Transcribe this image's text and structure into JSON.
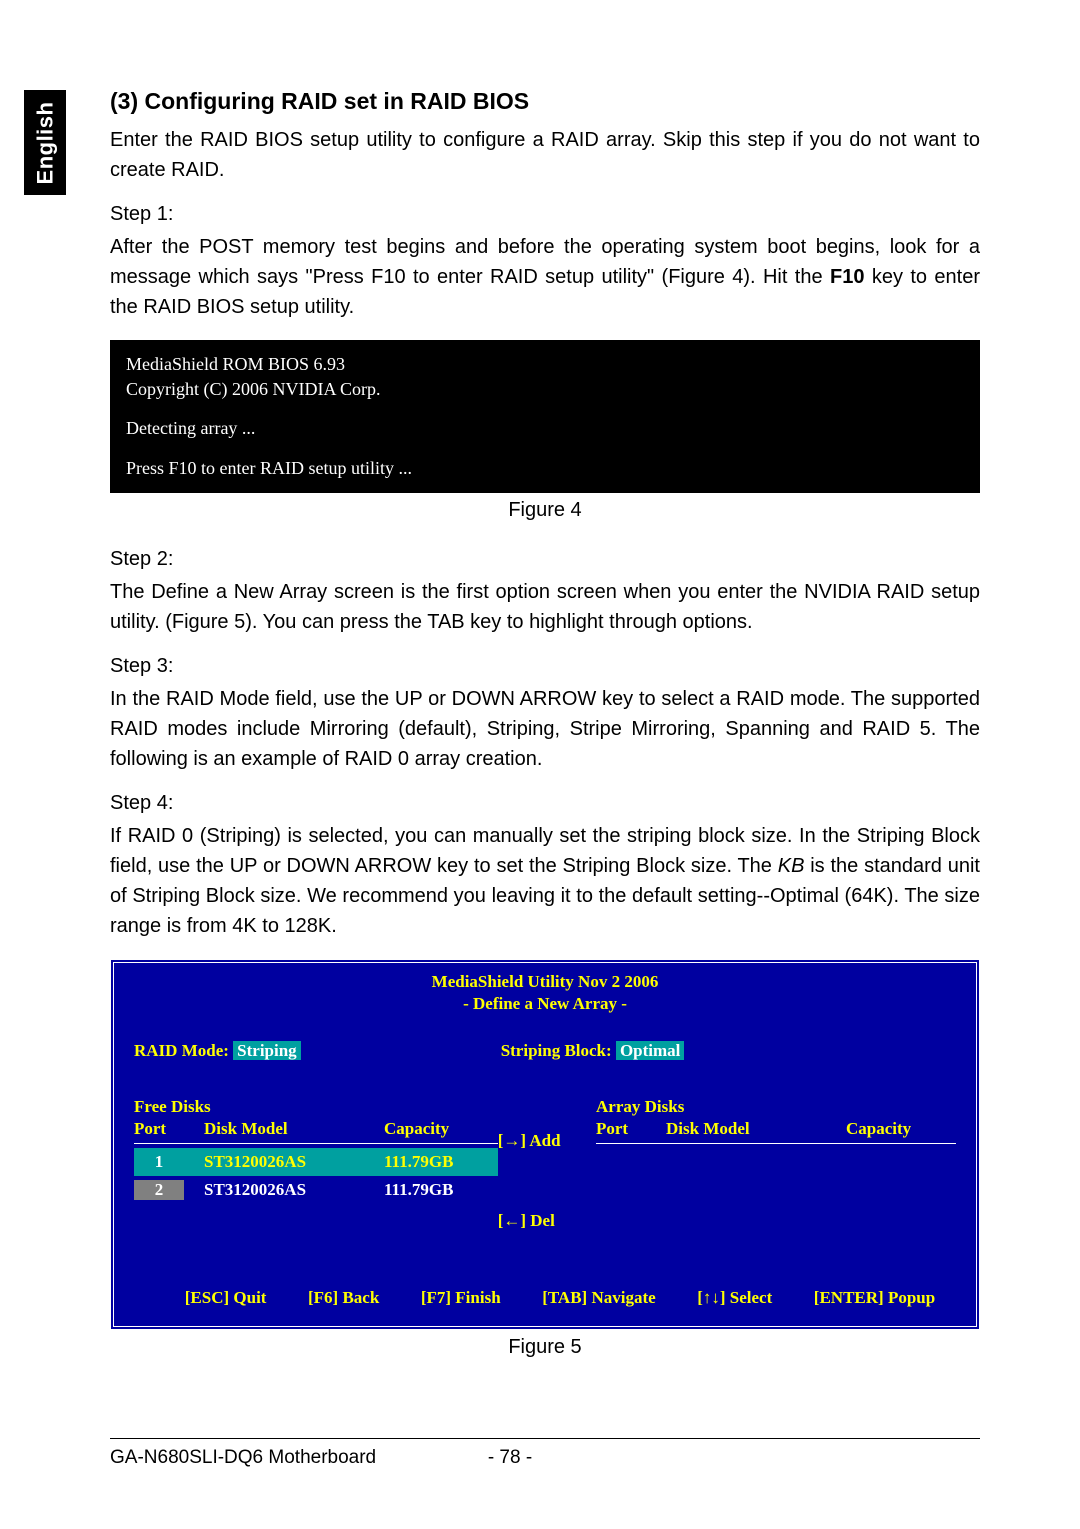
{
  "side_tab": "English",
  "heading": "(3)  Configuring RAID set in RAID BIOS",
  "intro": "Enter the RAID BIOS setup utility to configure a RAID array. Skip this step if you do not want to create RAID.",
  "step1_label": "Step 1:",
  "step1_text_before": "After the POST memory test begins and before the operating system boot begins, look for a message which says \"Press F10 to enter RAID setup utility\" (Figure 4). Hit the ",
  "step1_bold": "F10",
  "step1_text_after": " key to enter the RAID BIOS setup utility.",
  "figure4": {
    "line1": "MediaShield ROM BIOS 6.93",
    "line2": "Copyright (C) 2006 NVIDIA Corp.",
    "line3": "Detecting array ...",
    "line4": "Press F10 to enter RAID setup utility ..."
  },
  "figure4_caption": "Figure 4",
  "step2_label": "Step 2:",
  "step2_text": "The Define a New Array screen is the first option screen when you enter the NVIDIA RAID setup utility. (Figure 5). You can press the TAB key to highlight through options.",
  "step3_label": "Step 3:",
  "step3_text": "In the RAID Mode field, use the UP or DOWN ARROW key to select a RAID mode. The supported RAID modes include Mirroring (default), Striping, Stripe Mirroring, Spanning and RAID 5. The following is an example of RAID 0 array creation.",
  "step4_label": "Step 4:",
  "step4_text_p1": "If RAID 0 (Striping) is selected, you can manually set the striping block size. In the Striping Block field, use the UP or DOWN ARROW key to set the Striping Block size. The ",
  "step4_italic": "KB",
  "step4_text_p2": " is the standard unit of Striping Block size.  We recommend you leaving it to the default setting--Optimal (64K). The size range is from 4K to 128K.",
  "bios": {
    "title1": "MediaShield Utility  Nov 2 2006",
    "title2": "- Define a New Array -",
    "raid_mode_label": "RAID Mode:",
    "raid_mode_value": "Striping",
    "striping_block_label": "Striping Block:",
    "striping_block_value": "Optimal",
    "free_disks_title": "Free Disks",
    "array_disks_title": "Array Disks",
    "col_port": "Port",
    "col_model": "Disk  Model",
    "col_capacity": "Capacity",
    "disks": [
      {
        "port": "1",
        "model": "ST3120026AS",
        "capacity": "111.79GB",
        "selected": true
      },
      {
        "port": "2",
        "model": "ST3120026AS",
        "capacity": "111.79GB",
        "selected": false
      }
    ],
    "action_add": "[→] Add",
    "action_del": "[←] Del",
    "footer": {
      "quit": "[ESC] Quit",
      "back": "[F6] Back",
      "finish": "[F7] Finish",
      "navigate": "[TAB] Navigate",
      "select": "[↑↓] Select",
      "popup": "[ENTER] Popup"
    }
  },
  "figure5_caption": "Figure 5",
  "footer_product": "GA-N680SLI-DQ6 Motherboard",
  "footer_page": "- 78 -"
}
